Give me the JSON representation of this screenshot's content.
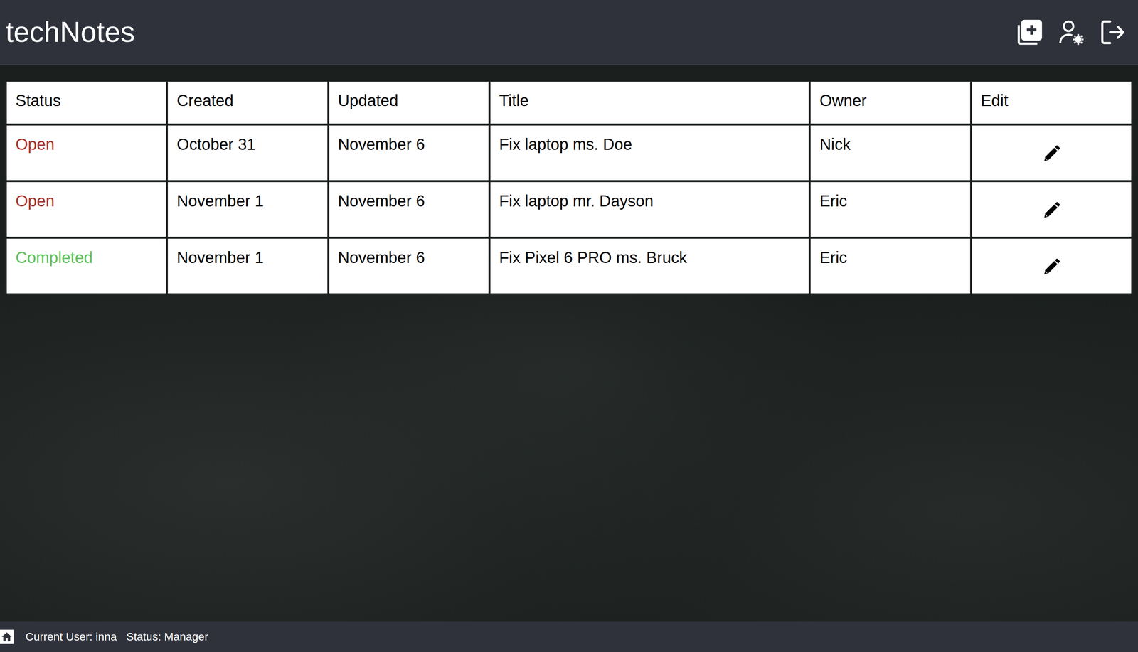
{
  "header": {
    "title": "techNotes"
  },
  "table": {
    "columns": [
      "Status",
      "Created",
      "Updated",
      "Title",
      "Owner",
      "Edit"
    ],
    "rows": [
      {
        "status": "Open",
        "color": "#a8322a",
        "created": "October 31",
        "updated": "November 6",
        "title": "Fix laptop ms. Doe",
        "owner": "Nick"
      },
      {
        "status": "Open",
        "color": "#a8322a",
        "created": "November 1",
        "updated": "November 6",
        "title": "Fix laptop mr. Dayson",
        "owner": "Eric"
      },
      {
        "status": "Completed",
        "color": "#5cc25a",
        "created": "November 1",
        "updated": "November 6",
        "title": "Fix Pixel 6 PRO ms. Bruck",
        "owner": "Eric"
      }
    ]
  },
  "status_bar": {
    "user": "Current User: inna",
    "status": "Status: Manager"
  }
}
